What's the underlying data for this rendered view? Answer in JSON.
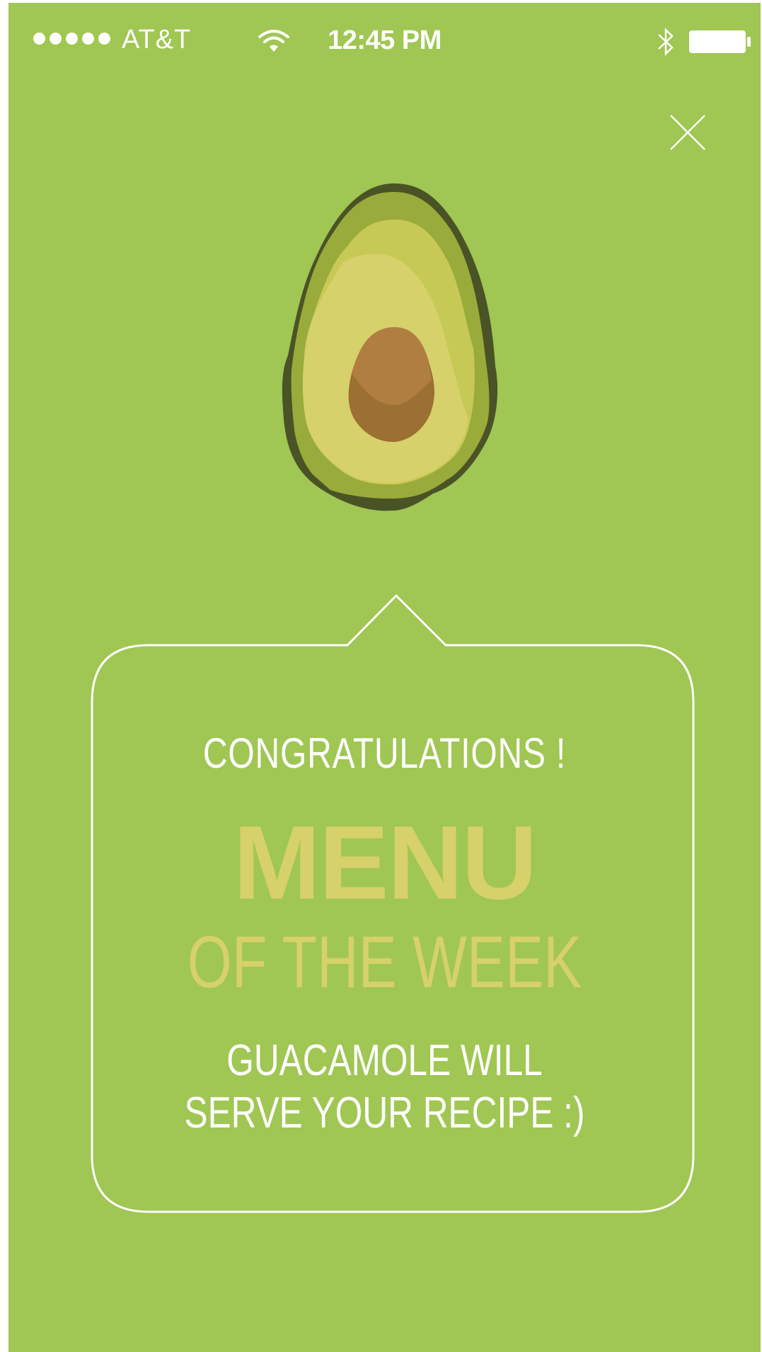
{
  "status_bar": {
    "carrier": "AT&T",
    "time": "12:45 PM",
    "signal_icon": "signal-dots-icon",
    "wifi_icon": "wifi-icon",
    "bluetooth_icon": "bluetooth-icon",
    "battery_icon": "battery-icon",
    "signal_strength": 5
  },
  "close_icon": "close-icon",
  "illustration": "avocado-illustration",
  "card": {
    "greeting": "CONGRATULATIONS !",
    "title": "MENU",
    "subtitle": "OF THE WEEK",
    "message_line1": "GUACAMOLE WILL",
    "message_line2": "SERVE YOUR RECIPE :)"
  },
  "colors": {
    "background": "#a0c653",
    "accent_text": "#d6d16a",
    "text": "#ffffff",
    "avocado_skin": "#4a5326",
    "avocado_flesh": "#d6d16a",
    "avocado_seed": "#b07e40"
  }
}
